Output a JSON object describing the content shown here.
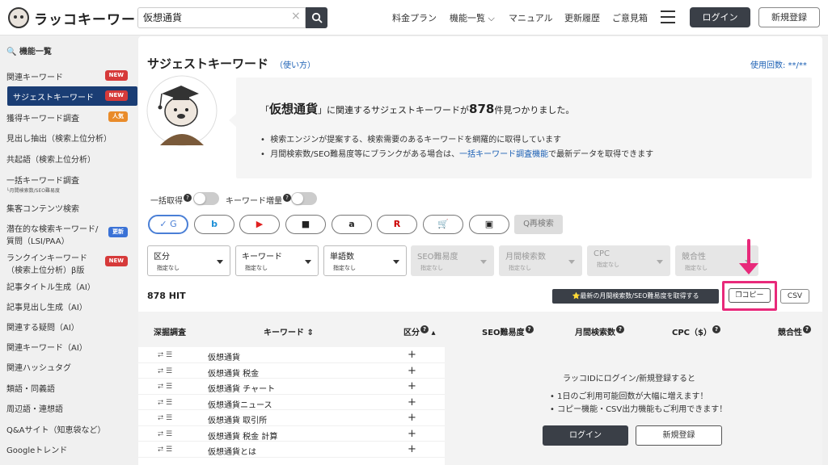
{
  "header": {
    "logo": "ラッコキーワード",
    "search_value": "仮想通貨",
    "nav": [
      "料金プラン",
      "機能一覧 ⌵",
      "マニュアル",
      "更新履歴",
      "ご意見箱"
    ],
    "login": "ログイン",
    "signup": "新規登録"
  },
  "sidebar": {
    "heading": "機能一覧",
    "items": [
      {
        "label": "関連キーワード",
        "badge": "NEW"
      },
      {
        "label": "サジェストキーワード",
        "badge": "NEW",
        "active": true
      },
      {
        "label": "獲得キーワード調査",
        "badge": "人気"
      },
      {
        "label": "見出し抽出（検索上位分析）"
      },
      {
        "label": "共起語（検索上位分析）"
      },
      {
        "label": "一括キーワード調査",
        "sub": "└月間検索数/SEO難易度"
      },
      {
        "label": "集客コンテンツ検索"
      },
      {
        "label": "潜在的な検索キーワード/",
        "label2": "質問（LSI/PAA）",
        "badge": "更新"
      },
      {
        "label": "ランクインキーワード",
        "label2": "（検索上位分析）β版",
        "badge": "NEW"
      },
      {
        "label": "記事タイトル生成（AI）"
      },
      {
        "label": "記事見出し生成（AI）"
      },
      {
        "label": "関連する疑問（AI）"
      },
      {
        "label": "関連キーワード（AI）"
      },
      {
        "label": "関連ハッシュタグ"
      },
      {
        "label": "類語・同義語"
      },
      {
        "label": "周辺語・連想語"
      },
      {
        "label": "Q&Aサイト（知恵袋など）"
      },
      {
        "label": "Googleトレンド"
      }
    ]
  },
  "main": {
    "title": "サジェストキーワード",
    "howto": "（使い方）",
    "usage": "使用回数: **/**",
    "result_open": "「",
    "result_keyword": "仮想通貨",
    "result_mid": "」に関連するサジェストキーワードが",
    "result_count": "878",
    "result_tail": "件見つかりました。",
    "bullet1": "検索エンジンが提案する、検索需要のあるキーワードを網羅的に取得しています",
    "bullet2_pre": "月間検索数/SEO難易度等にブランクがある場合は、",
    "bullet2_link": "一括キーワード調査機能",
    "bullet2_post": "で最新データを取得できます",
    "toggle1": "一括取得",
    "toggle2": "キーワード増量",
    "engines": [
      "✓ G",
      "b",
      "▶",
      "■",
      "a",
      "R",
      "🛒",
      "▣"
    ],
    "research": "Q再検索",
    "filters": [
      {
        "name": "区分",
        "value": "指定なし",
        "disabled": false
      },
      {
        "name": "キーワード",
        "value": "指定なし",
        "disabled": false
      },
      {
        "name": "単語数",
        "value": "指定なし",
        "disabled": false
      },
      {
        "name": "SEO難易度",
        "value": "指定なし",
        "disabled": true
      },
      {
        "name": "月間検索数",
        "value": "指定なし",
        "disabled": true
      },
      {
        "name": "CPC",
        "value": "指定なし",
        "disabled": true
      },
      {
        "name": "競合性",
        "value": "指定なし",
        "disabled": true
      }
    ],
    "hits": "878 HIT",
    "fetch_button": "⭐最新の月間検索数/SEO難易度を取得する",
    "copy_button": "コピー",
    "csv_button": "CSV"
  },
  "table": {
    "headers": [
      "深掘調査",
      "キーワード ⇕",
      "区分",
      "SEO難易度",
      "月間検索数",
      "CPC（$）",
      "競合性"
    ],
    "rows": [
      "仮想通貨",
      "仮想通貨 税金",
      "仮想通貨 チャート",
      "仮想通貨ニュース",
      "仮想通貨 取引所",
      "仮想通貨 税金 計算",
      "仮想通貨とは"
    ],
    "gate_text": "ラッコIDにログイン/新規登録すると",
    "gate_b1": "1日のご利用可能回数が大幅に増えます！",
    "gate_b2": "コピー機能・CSV出力機能もご利用できます！",
    "gate_login": "ログイン",
    "gate_signup": "新規登録"
  }
}
